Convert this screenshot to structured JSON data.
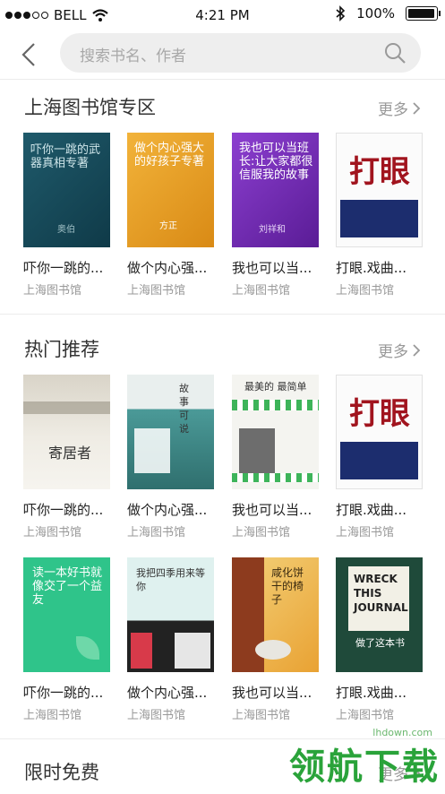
{
  "status": {
    "carrier": "BELL",
    "time": "4:21 PM",
    "battery": "100%"
  },
  "search": {
    "placeholder": "搜索书名、作者"
  },
  "sections": [
    {
      "title": "上海图书馆专区",
      "more": "更多"
    },
    {
      "title": "热门推荐",
      "more": "更多"
    },
    {
      "title": "限时免费",
      "more": "更多"
    }
  ],
  "books": {
    "row1": [
      {
        "title": "吓你一跳的...",
        "source": "上海图书馆",
        "cover_text": "吓你一跳的武器真相专著",
        "cover_sub": "奥伯"
      },
      {
        "title": "做个内心强...",
        "source": "上海图书馆",
        "cover_text": "做个内心强大的好孩子专著",
        "cover_sub": "方正"
      },
      {
        "title": "我也可以当...",
        "source": "上海图书馆",
        "cover_text": "我也可以当班长:让大家都很信服我的故事",
        "cover_sub": "刘祥和"
      },
      {
        "title": "打眼.戏曲...",
        "source": "上海图书馆",
        "cover_text": "打眼"
      }
    ],
    "row2": [
      {
        "title": "吓你一跳的...",
        "source": "上海图书馆",
        "cover_text": "寄居者"
      },
      {
        "title": "做个内心强...",
        "source": "上海图书馆",
        "cover_text": "故事可说"
      },
      {
        "title": "我也可以当...",
        "source": "上海图书馆",
        "cover_text": "最美的 最简单"
      },
      {
        "title": "打眼.戏曲...",
        "source": "上海图书馆",
        "cover_text": "打眼"
      }
    ],
    "row3": [
      {
        "title": "吓你一跳的...",
        "source": "上海图书馆",
        "cover_text": "读一本好书就像交了一个益友"
      },
      {
        "title": "做个内心强...",
        "source": "上海图书馆",
        "cover_text": "我把四季用来等你"
      },
      {
        "title": "我也可以当...",
        "source": "上海图书馆",
        "cover_text": "咸化饼干的椅子"
      },
      {
        "title": "打眼.戏曲...",
        "source": "上海图书馆",
        "cover_text": "WRECK THIS JOURNAL",
        "cover_sub": "做了这本书"
      }
    ]
  },
  "watermark": {
    "text": "领航下载",
    "site": "lhdown.com"
  }
}
